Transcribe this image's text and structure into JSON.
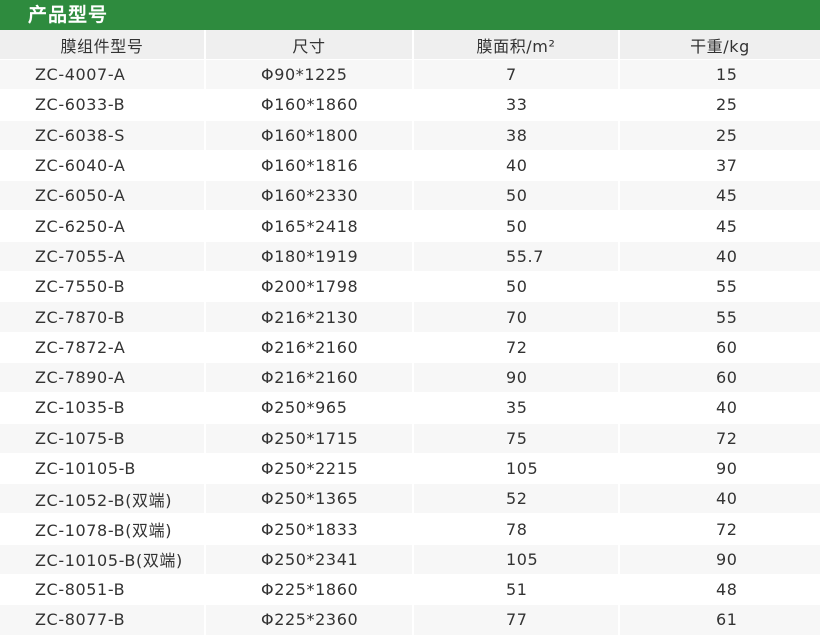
{
  "title": "产品型号",
  "columns": [
    "膜组件型号",
    "尺寸",
    "膜面积/m²",
    "干重/kg"
  ],
  "rows": [
    [
      "ZC-4007-A",
      "Φ90*1225",
      "7",
      "15"
    ],
    [
      "ZC-6033-B",
      "Φ160*1860",
      "33",
      "25"
    ],
    [
      "ZC-6038-S",
      "Φ160*1800",
      "38",
      "25"
    ],
    [
      "ZC-6040-A",
      "Φ160*1816",
      "40",
      "37"
    ],
    [
      "ZC-6050-A",
      "Φ160*2330",
      "50",
      "45"
    ],
    [
      "ZC-6250-A",
      "Φ165*2418",
      "50",
      "45"
    ],
    [
      "ZC-7055-A",
      "Φ180*1919",
      "55.7",
      "40"
    ],
    [
      "ZC-7550-B",
      "Φ200*1798",
      "50",
      "55"
    ],
    [
      "ZC-7870-B",
      "Φ216*2130",
      "70",
      "55"
    ],
    [
      "ZC-7872-A",
      "Φ216*2160",
      "72",
      "60"
    ],
    [
      "ZC-7890-A",
      "Φ216*2160",
      "90",
      "60"
    ],
    [
      "ZC-1035-B",
      "Φ250*965",
      "35",
      "40"
    ],
    [
      "ZC-1075-B",
      "Φ250*1715",
      "75",
      "72"
    ],
    [
      "ZC-10105-B",
      "Φ250*2215",
      "105",
      "90"
    ],
    [
      "ZC-1052-B(双端)",
      "Φ250*1365",
      "52",
      "40"
    ],
    [
      "ZC-1078-B(双端)",
      "Φ250*1833",
      "78",
      "72"
    ],
    [
      "ZC-10105-B(双端)",
      "Φ250*2341",
      "105",
      "90"
    ],
    [
      "ZC-8051-B",
      "Φ225*1860",
      "51",
      "48"
    ],
    [
      "ZC-8077-B",
      "Φ225*2360",
      "77",
      "61"
    ]
  ]
}
